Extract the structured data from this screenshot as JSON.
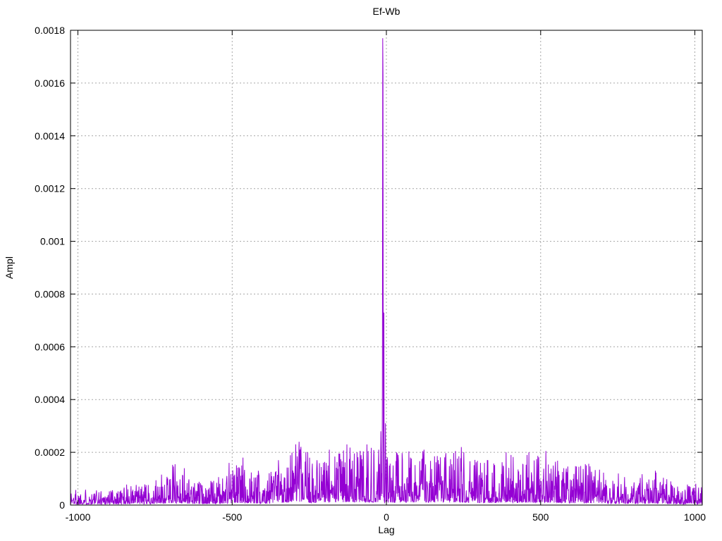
{
  "title": "Ef-Wb",
  "axes": {
    "x": {
      "label": "Lag",
      "tick_labels": [
        "-1000",
        "-500",
        "0",
        "500",
        "1000"
      ]
    },
    "y": {
      "label": "Ampl",
      "tick_labels": [
        "0",
        "0.0002",
        "0.0004",
        "0.0006",
        "0.0008",
        "0.001",
        "0.0012",
        "0.0014",
        "0.0016",
        "0.0018"
      ]
    }
  },
  "chart_data": {
    "type": "line",
    "title": "Ef-Wb",
    "xlabel": "Lag",
    "ylabel": "Ampl",
    "xlim": [
      -1024,
      1024
    ],
    "ylim": [
      0,
      0.0018
    ],
    "x_tick_values": [
      -1000,
      -500,
      0,
      500,
      1000
    ],
    "y_tick_values": [
      0,
      0.0002,
      0.0004,
      0.0006,
      0.0008,
      0.001,
      0.0012,
      0.0014,
      0.0016,
      0.0018
    ],
    "grid": "dotted",
    "grid_color": "#a6a6a6",
    "legend": "none",
    "line_color": "#9400d3",
    "border_color": "#000000",
    "description": "Cross-correlation amplitude vs lag: broadband impulse-like noise floor (~0.00003-0.0001) rising toward the center with occasional spikes to ~0.0002, and a single dominant narrow peak of 0.00177 just left of zero lag.",
    "main_peak": {
      "lag": -12,
      "value": 0.00177
    },
    "peak_cluster": [
      [
        -18,
        0.00028
      ],
      [
        -13,
        0.00045
      ],
      [
        -12,
        0.00177
      ],
      [
        -11,
        0.00163
      ],
      [
        -10,
        0.0003
      ],
      [
        -8,
        0.00073
      ],
      [
        -3,
        0.00031
      ]
    ],
    "noise_envelope": [
      [
        -1024,
        7e-05
      ],
      [
        -940,
        6e-05
      ],
      [
        -850,
        8e-05
      ],
      [
        -760,
        8e-05
      ],
      [
        -690,
        0.00016
      ],
      [
        -620,
        9e-05
      ],
      [
        -550,
        0.0001
      ],
      [
        -480,
        0.00017
      ],
      [
        -420,
        0.00012
      ],
      [
        -350,
        0.00016
      ],
      [
        -290,
        0.00024
      ],
      [
        -230,
        0.00016
      ],
      [
        -170,
        0.00021
      ],
      [
        -110,
        0.00023
      ],
      [
        -60,
        0.00023
      ],
      [
        -25,
        0.0002
      ],
      [
        0,
        0.00019
      ],
      [
        40,
        0.0002
      ],
      [
        100,
        0.00021
      ],
      [
        170,
        0.00019
      ],
      [
        240,
        0.00022
      ],
      [
        310,
        0.00017
      ],
      [
        380,
        0.0002
      ],
      [
        450,
        0.00019
      ],
      [
        520,
        0.00021
      ],
      [
        590,
        0.00015
      ],
      [
        660,
        0.00016
      ],
      [
        730,
        0.00012
      ],
      [
        800,
        0.00011
      ],
      [
        870,
        0.00013
      ],
      [
        940,
        9e-05
      ],
      [
        1024,
        8e-05
      ]
    ],
    "notable_spikes": [
      [
        -685,
        0.000155
      ],
      [
        -655,
        0.00014
      ],
      [
        -510,
        0.00016
      ],
      [
        -465,
        0.00018
      ],
      [
        -415,
        0.00013
      ],
      [
        -350,
        0.00017
      ],
      [
        -283,
        0.00024
      ],
      [
        -255,
        0.0002
      ],
      [
        -225,
        0.00017
      ],
      [
        -185,
        0.00021
      ],
      [
        -152,
        0.00019
      ],
      [
        -128,
        0.00023
      ],
      [
        -95,
        0.0002
      ],
      [
        -63,
        0.00023
      ],
      [
        -40,
        0.00019
      ],
      [
        -25,
        0.00021
      ],
      [
        33,
        0.0002
      ],
      [
        78,
        0.00018
      ],
      [
        122,
        0.00021
      ],
      [
        168,
        0.00017
      ],
      [
        243,
        0.00022
      ],
      [
        305,
        0.00016
      ],
      [
        388,
        0.0002
      ],
      [
        404,
        0.00019
      ],
      [
        462,
        0.0002
      ],
      [
        517,
        0.000205
      ],
      [
        575,
        0.00014
      ],
      [
        648,
        0.00015
      ],
      [
        752,
        0.00012
      ],
      [
        872,
        0.00013
      ]
    ],
    "noise_seed": 1337,
    "n_points": 2049
  }
}
